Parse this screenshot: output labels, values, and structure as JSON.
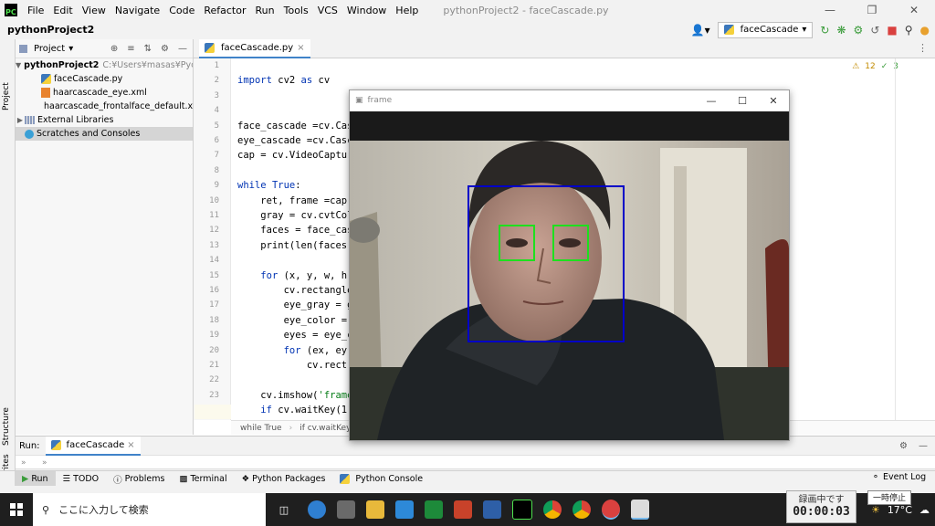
{
  "app": {
    "logo_text": "PC",
    "window_title": "pythonProject2 - faceCascade.py",
    "menus": [
      "File",
      "Edit",
      "View",
      "Navigate",
      "Code",
      "Refactor",
      "Run",
      "Tools",
      "VCS",
      "Window",
      "Help"
    ]
  },
  "navbar": {
    "project_crumb": "pythonProject2",
    "run_config": "faceCascade"
  },
  "project_panel": {
    "header": "Project",
    "stripe_label": "Project",
    "tree": [
      {
        "label": "pythonProject2",
        "path": "C:¥Users¥masas¥Pycharm",
        "type": "folder",
        "indent": 0
      },
      {
        "label": "faceCascade.py",
        "type": "py",
        "indent": 2
      },
      {
        "label": "haarcascade_eye.xml",
        "type": "xml",
        "indent": 2
      },
      {
        "label": "haarcascade_frontalface_default.xml",
        "type": "xml",
        "indent": 2
      },
      {
        "label": "External Libraries",
        "type": "lib",
        "indent": 0
      },
      {
        "label": "Scratches and Consoles",
        "type": "scratch",
        "indent": 0
      }
    ],
    "side_labels": [
      "Structure",
      "Favorites"
    ]
  },
  "editor": {
    "tab": "faceCascade.py",
    "inspections": {
      "warnings": "12",
      "ok": "3"
    },
    "lines": [
      "",
      "import cv2 as cv",
      "",
      "",
      "face_cascade =cv.Casc",
      "eye_cascade =cv.Casca",
      "cap = cv.VideoCaptur",
      "",
      "while True:",
      "    ret, frame =cap.r",
      "    gray = cv.cvtColo",
      "    faces = face_casc",
      "    print(len(faces)",
      "",
      "    for (x, y, w, h)",
      "        cv.rectangle",
      "        eye_gray = g",
      "        eye_color =",
      "        eyes = eye_c",
      "        for (ex, ey",
      "            cv.rect",
      "",
      "    cv.imshow('frame",
      "    if cv.waitKey(1)"
    ],
    "breadcrumb": [
      "while True",
      "if cv.waitKey(1)"
    ]
  },
  "run_panel": {
    "label": "Run:",
    "tab": "faceCascade"
  },
  "bottom_tools": [
    "Run",
    "TODO",
    "Problems",
    "Terminal",
    "Python Packages",
    "Python Console"
  ],
  "event_log": "Event Log",
  "frame_window": {
    "title": "frame"
  },
  "taskbar": {
    "search_placeholder": "ここに入力して検索",
    "weather": "17°C",
    "recording_label": "録画中です",
    "recording_time": "00:00:03",
    "pause_label": "一時停止"
  },
  "colors": {
    "face_box": "#0000c8",
    "eye_box": "#1ee01e",
    "accent": "#4083c9"
  }
}
